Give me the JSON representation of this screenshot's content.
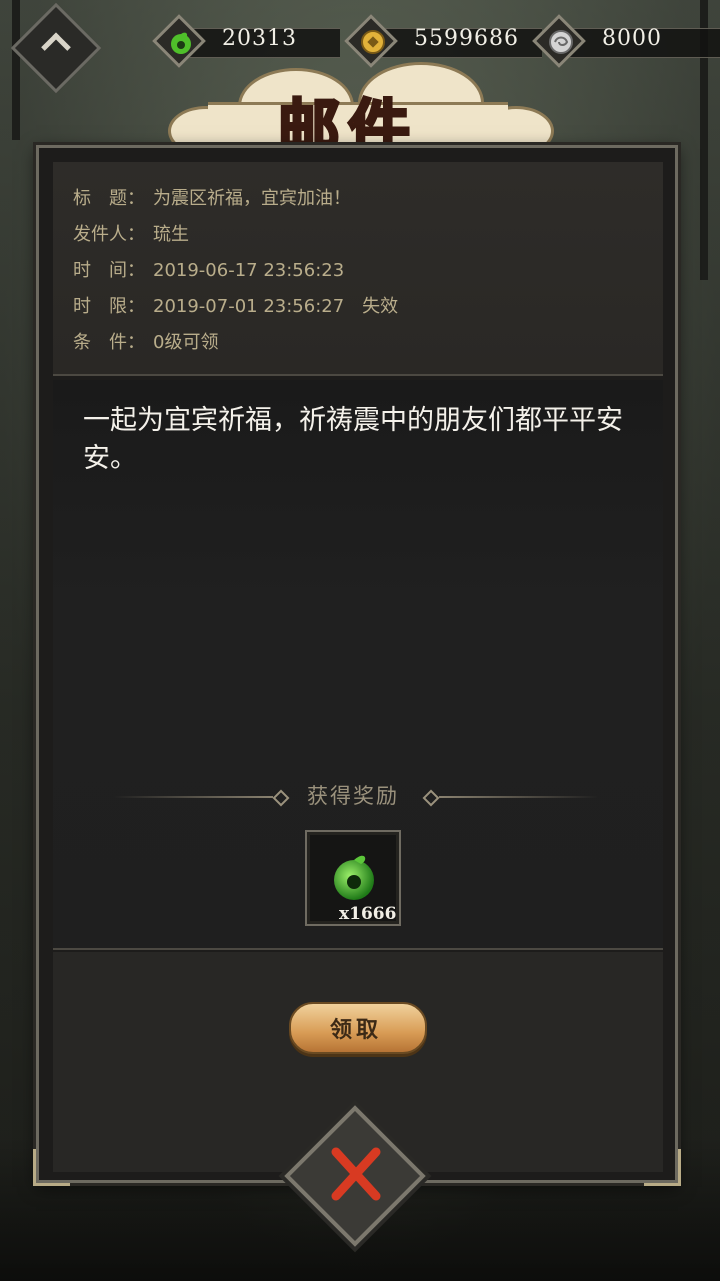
{
  "resources": [
    {
      "icon": "jade-magatama-icon",
      "value": "20313",
      "color": "#6bd23a"
    },
    {
      "icon": "gold-coin-icon",
      "value": "5599686",
      "color": "#e2b23a"
    },
    {
      "icon": "silver-coin-icon",
      "value": "8000",
      "color": "#c9c9c9"
    }
  ],
  "window_title": "邮件",
  "mail": {
    "meta": [
      {
        "label": "标　题：",
        "value": "为震区祈福，宜宾加油！"
      },
      {
        "label": "发件人：",
        "value": "琉生"
      },
      {
        "label": "时　间：",
        "value": "2019-06-17 23:56:23"
      },
      {
        "label": "时　限：",
        "value": "2019-07-01 23:56:27　失效"
      },
      {
        "label": "条　件：",
        "value": "0级可领"
      }
    ],
    "body": "一起为宜宾祈福，祈祷震中的朋友们都平平安安。",
    "reward_title": "获得奖励",
    "rewards": [
      {
        "icon": "jade-magatama-icon",
        "quantity": "x1666"
      }
    ],
    "claim_label": "领取"
  },
  "colors": {
    "accent_gold": "#d89c55",
    "close_red": "#d83a22",
    "meta_text": "#b9ad8b"
  }
}
